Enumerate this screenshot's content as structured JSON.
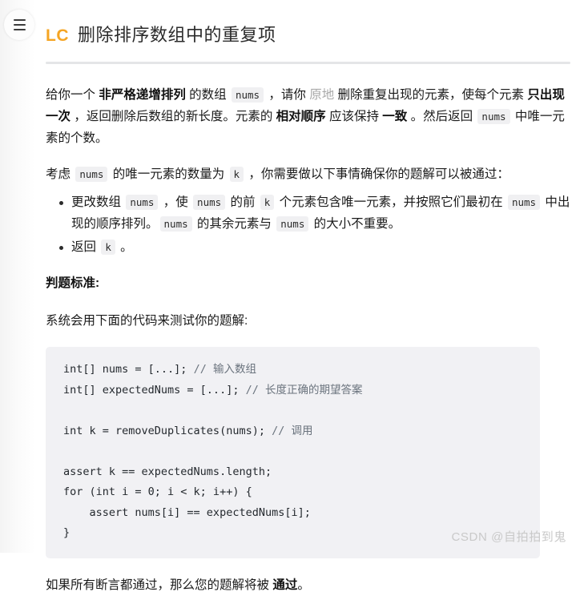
{
  "window": {
    "background": "#ffffff",
    "accent_orange": "#f5a524",
    "code_bg": "#f1f1f4"
  },
  "sidebar": {
    "toggle_label": "menu-toggle",
    "collapsed": true
  },
  "header": {
    "logo_text": "LC",
    "title": "删除排序数组中的重复项"
  },
  "content": {
    "intro": {
      "seg1": "给你一个 ",
      "bold1": "非严格递增排列",
      "seg2": " 的数组 ",
      "code1": "nums",
      "seg3": " ，请你 ",
      "link1": "原地",
      "seg4": " 删除重复出现的元素，使每个元素 ",
      "bold2": "只出现一次",
      "seg5": " ，返回删除后数组的新长度。元素的 ",
      "bold3": "相对顺序",
      "seg6": " 应该保持 ",
      "bold4": "一致",
      "seg7": " 。然后返回 ",
      "code2": "nums",
      "seg8": " 中唯一元素的个数。"
    },
    "consider": {
      "seg1": "考虑 ",
      "code1": "nums",
      "seg2": " 的唯一元素的数量为 ",
      "code2": "k",
      "seg3": " ，你需要做以下事情确保你的题解可以被通过："
    },
    "requirements": [
      {
        "seg1": "更改数组 ",
        "code1": "nums",
        "seg2": " ，使 ",
        "code2": "nums",
        "seg3": " 的前 ",
        "code3": "k",
        "seg4": " 个元素包含唯一元素，并按照它们最初在 ",
        "code4": "nums",
        "seg5": " 中出现的顺序排列。",
        "code5": "nums",
        "seg6": " 的其余元素与 ",
        "code6": "nums",
        "seg7": " 的大小不重要。"
      },
      {
        "seg1": "返回 ",
        "code1": "k",
        "seg2": " 。"
      }
    ],
    "judging_heading": "判题标准:",
    "system_test_note": "系统会用下面的代码来测试你的题解:",
    "code_sample": {
      "line1_code": "int[] nums = [...]; ",
      "line1_comment": "// 输入数组",
      "line2_code": "int[] expectedNums = [...]; ",
      "line2_comment": "// 长度正确的期望答案",
      "line3_blank": "",
      "line4_code": "int k = removeDuplicates(nums); ",
      "line4_comment": "// 调用",
      "line5_blank": "",
      "line6_code": "assert k == expectedNums.length;",
      "line7_code": "for (int i = 0; i < k; i++) {",
      "line8_code": "    assert nums[i] == expectedNums[i];",
      "line9_code": "}"
    },
    "conclusion": {
      "seg1": "如果所有断言都通过，那么您的题解将被 ",
      "bold1": "通过",
      "seg2": "。"
    }
  },
  "watermark": {
    "text": "CSDN @自拍拍到鬼"
  }
}
